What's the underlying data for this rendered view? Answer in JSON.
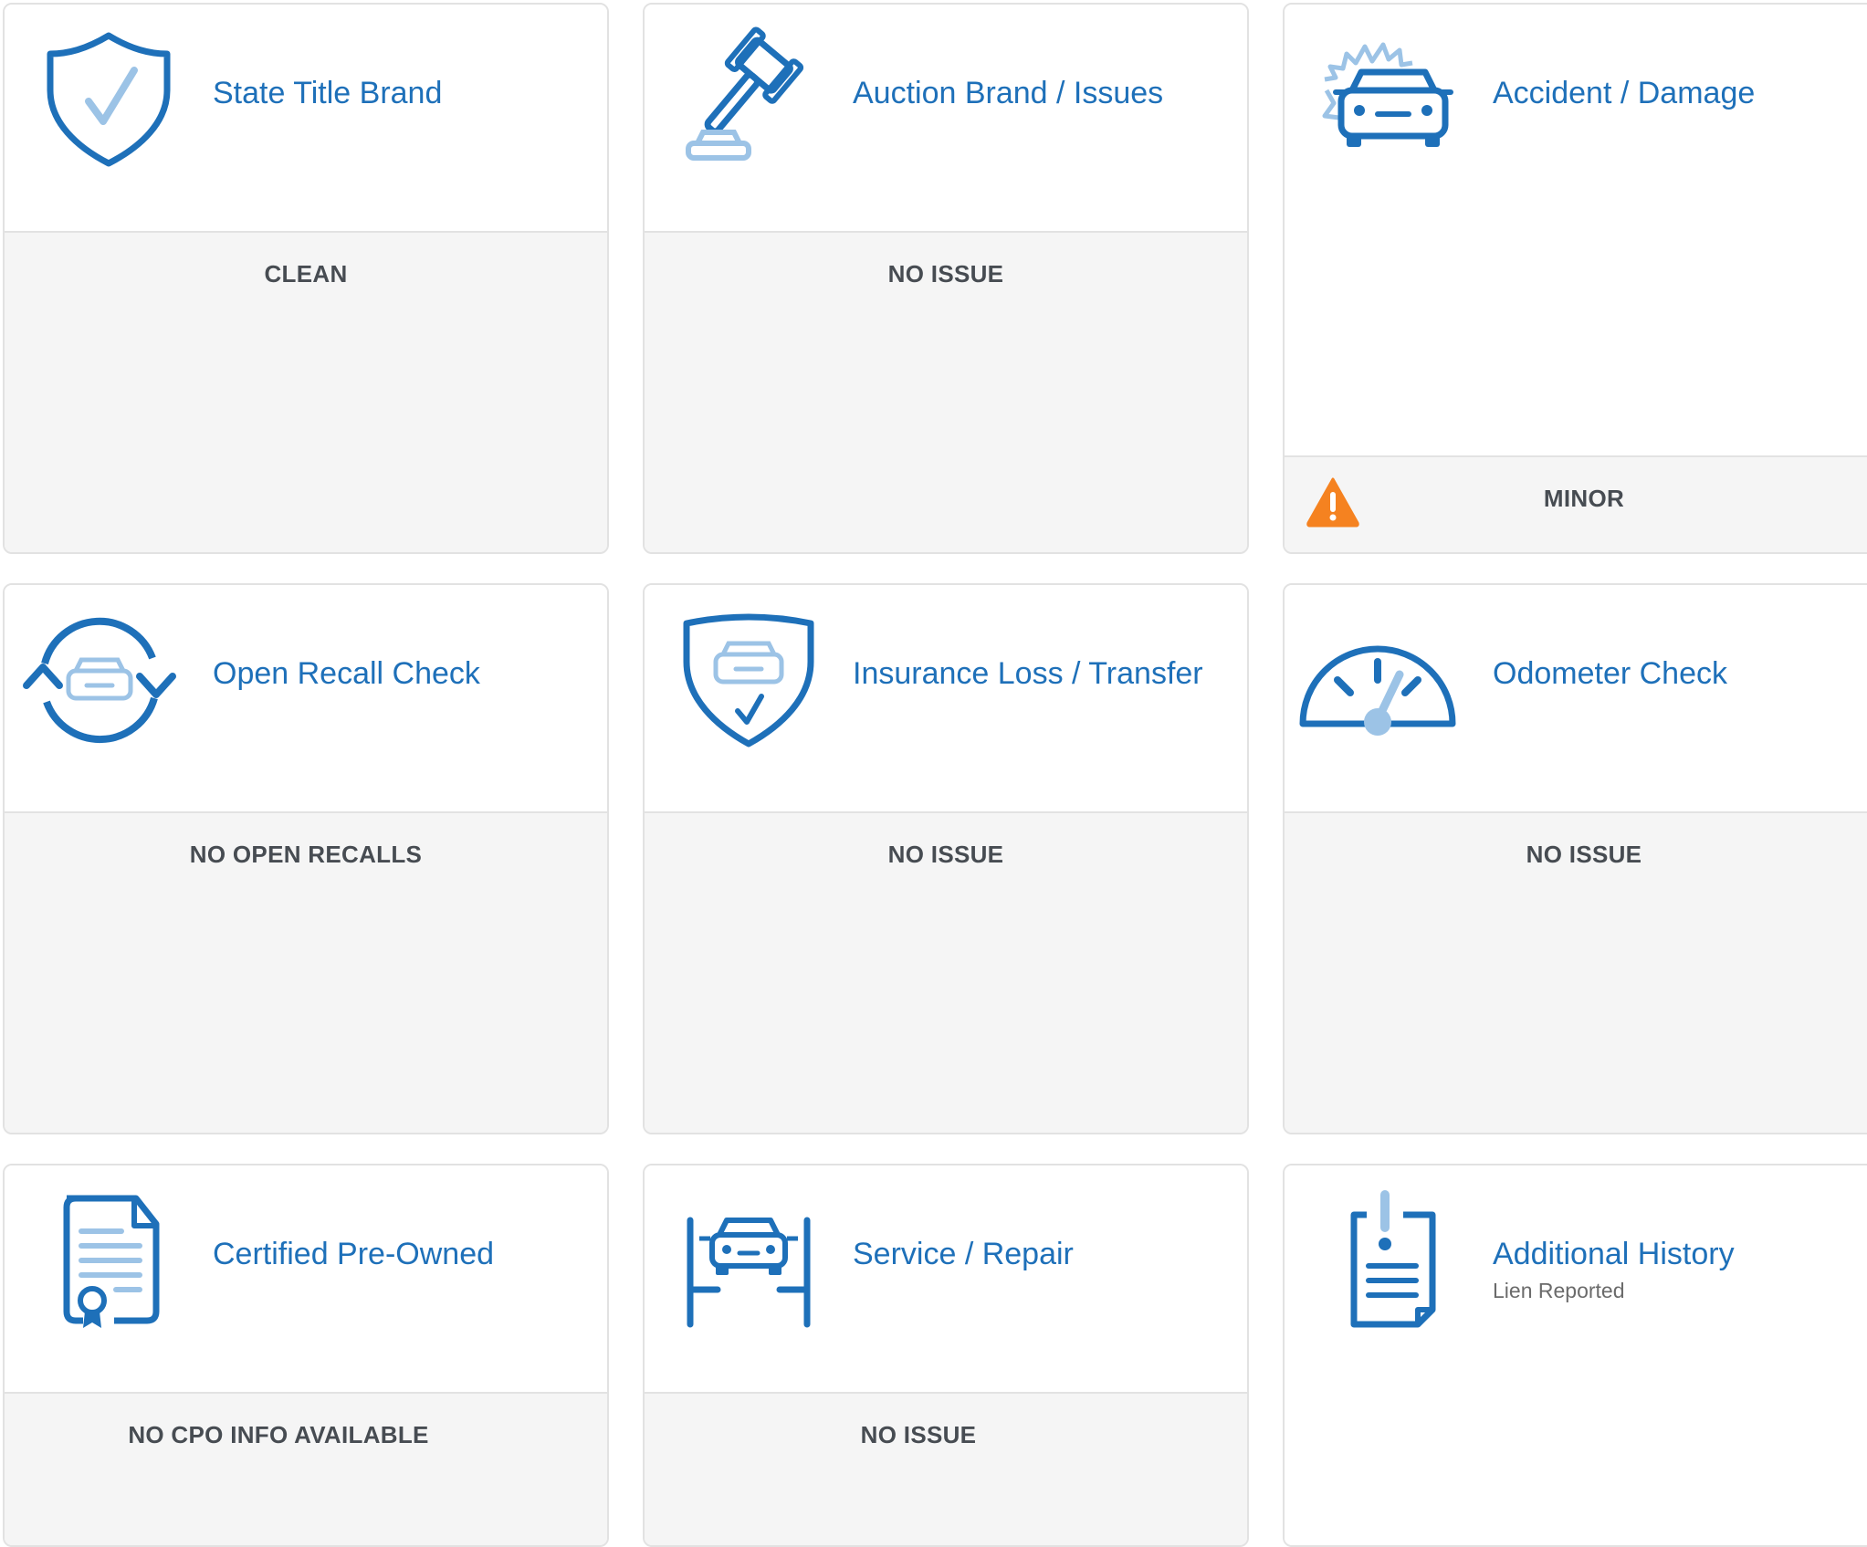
{
  "colors": {
    "accent": "#1e70b9",
    "accent_light": "#9cc3e6",
    "status_text": "#474c52",
    "card_border": "#e2e2e2",
    "card_bottom_bg": "#f5f5f5",
    "warning": "#f58220"
  },
  "cards": [
    {
      "title": "State Title Brand",
      "status": "CLEAN",
      "icon": "shield-check-icon"
    },
    {
      "title": "Auction Brand / Issues",
      "status": "NO ISSUE",
      "icon": "gavel-icon"
    },
    {
      "title": "Accident / Damage",
      "status": "MINOR",
      "icon": "car-crash-icon",
      "status_icon": "warning-icon"
    },
    {
      "title": "Open Recall Check",
      "status": "NO OPEN RECALLS",
      "icon": "recall-cycle-icon"
    },
    {
      "title": "Insurance Loss / Transfer",
      "status": "NO ISSUE",
      "icon": "shield-car-icon"
    },
    {
      "title": "Odometer Check",
      "status": "NO ISSUE",
      "icon": "odometer-icon"
    },
    {
      "title": "Certified Pre-Owned",
      "status": "NO CPO INFO AVAILABLE",
      "icon": "certificate-document-icon"
    },
    {
      "title": "Service / Repair",
      "status": "NO ISSUE",
      "icon": "car-lift-icon"
    },
    {
      "title": "Additional History",
      "subtitle": "Lien Reported",
      "icon": "clipboard-alert-icon"
    }
  ]
}
